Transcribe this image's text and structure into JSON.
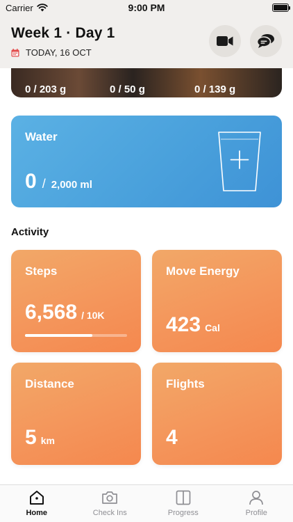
{
  "status": {
    "carrier": "Carrier",
    "time": "9:00 PM"
  },
  "header": {
    "title": "Week 1 · Day 1",
    "date": "TODAY, 16 OCT"
  },
  "food": {
    "macros": [
      "0 / 203 g",
      "0 / 50 g",
      "0 / 139 g"
    ]
  },
  "water": {
    "label": "Water",
    "value": "0",
    "separator": "/",
    "total": "2,000 ml"
  },
  "activity": {
    "title": "Activity",
    "steps": {
      "label": "Steps",
      "value": "6,568",
      "goal": "/ 10K",
      "progress": 0.657
    },
    "move": {
      "label": "Move Energy",
      "value": "423",
      "unit": "Cal"
    },
    "distance": {
      "label": "Distance",
      "value": "5",
      "unit": "km"
    },
    "flights": {
      "label": "Flights",
      "value": "4"
    }
  },
  "tabs": [
    {
      "label": "Home",
      "icon": "home-icon",
      "active": true
    },
    {
      "label": "Check Ins",
      "icon": "camera-icon",
      "active": false
    },
    {
      "label": "Progress",
      "icon": "split-square-icon",
      "active": false
    },
    {
      "label": "Profile",
      "icon": "person-icon",
      "active": false
    }
  ],
  "colors": {
    "water": "#4aa1dc",
    "tile": "#f4945a",
    "header": "#f1efed"
  }
}
